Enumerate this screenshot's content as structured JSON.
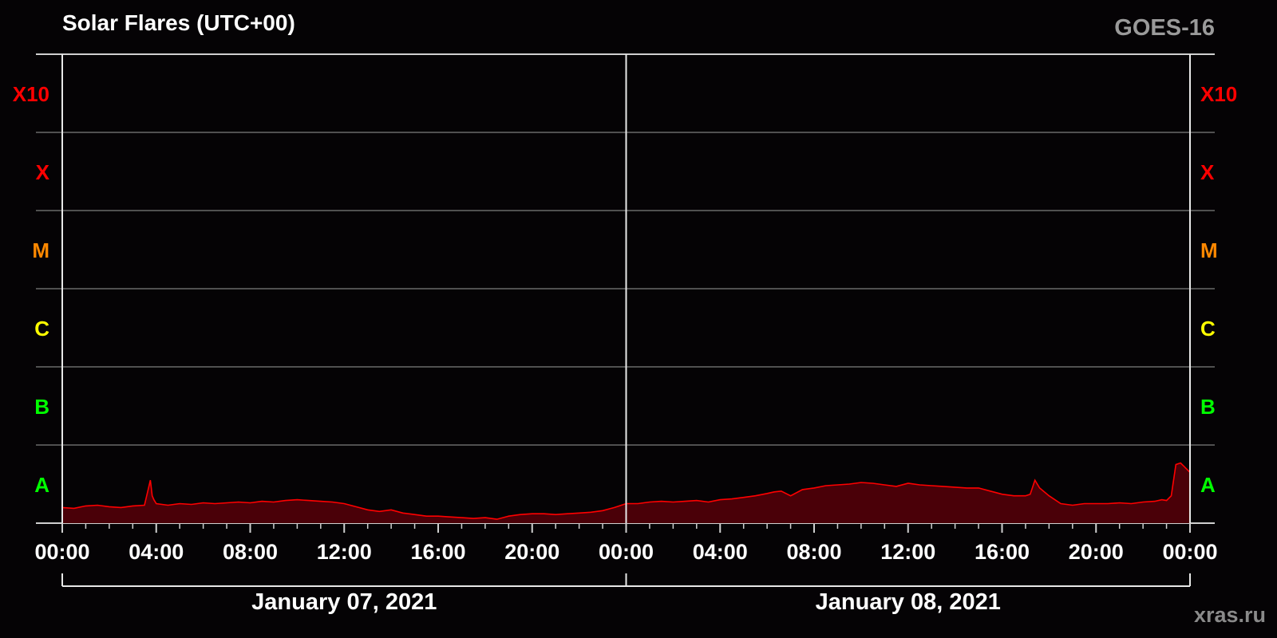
{
  "chart_data": {
    "type": "area",
    "title": "Solar Flares (UTC+00)",
    "satellite": "GOES-16",
    "credit": "xras.ru",
    "y_classes": [
      {
        "label": "A",
        "color": "#00ff00"
      },
      {
        "label": "B",
        "color": "#00ff00"
      },
      {
        "label": "C",
        "color": "#ffff00"
      },
      {
        "label": "M",
        "color": "#ff8800"
      },
      {
        "label": "X",
        "color": "#ff0000"
      },
      {
        "label": "X10",
        "color": "#ff0000"
      }
    ],
    "y_scale": "log10 X-ray flux class, band 0 = A (1e-8 W/m2) ... band 5 = X10",
    "ylim": [
      0,
      6
    ],
    "x_ticks": [
      "00:00",
      "04:00",
      "08:00",
      "12:00",
      "16:00",
      "20:00",
      "00:00",
      "04:00",
      "08:00",
      "12:00",
      "16:00",
      "20:00",
      "00:00"
    ],
    "xlim_hours": [
      0,
      48
    ],
    "dates": [
      {
        "label": "January 07, 2021",
        "start_hour": 0,
        "end_hour": 24
      },
      {
        "label": "January 08, 2021",
        "start_hour": 24,
        "end_hour": 48
      }
    ],
    "grid": true,
    "series": [
      {
        "color": "#ff0000",
        "fill": "#4a0008",
        "x_hours": [
          0,
          0.5,
          1,
          1.5,
          2,
          2.5,
          3,
          3.5,
          3.75,
          3.83,
          3.9,
          4,
          4.5,
          5,
          5.5,
          6,
          6.5,
          7,
          7.5,
          8,
          8.5,
          9,
          9.5,
          10,
          10.5,
          11,
          11.5,
          12,
          12.5,
          13,
          13.5,
          14,
          14.5,
          15,
          15.5,
          16,
          16.5,
          17,
          17.5,
          18,
          18.5,
          19,
          19.5,
          20,
          20.5,
          21,
          21.5,
          22,
          22.5,
          23,
          23.5,
          24,
          24.5,
          25,
          25.5,
          26,
          26.5,
          27,
          27.5,
          28,
          28.5,
          29,
          29.5,
          30,
          30.3,
          30.6,
          31,
          31.5,
          32,
          32.5,
          33,
          33.5,
          34,
          34.5,
          35,
          35.5,
          36,
          36.5,
          37,
          37.5,
          38,
          38.5,
          39,
          39.5,
          40,
          40.5,
          41,
          41.2,
          41.4,
          41.6,
          42,
          42.5,
          43,
          43.5,
          44,
          44.5,
          45,
          45.5,
          46,
          46.5,
          46.8,
          47,
          47.2,
          47.4,
          47.6,
          48
        ],
        "y_band": [
          0.15,
          0.14,
          0.17,
          0.18,
          0.16,
          0.15,
          0.17,
          0.18,
          0.5,
          0.3,
          0.25,
          0.2,
          0.18,
          0.2,
          0.19,
          0.21,
          0.2,
          0.21,
          0.22,
          0.21,
          0.23,
          0.22,
          0.24,
          0.25,
          0.24,
          0.23,
          0.22,
          0.2,
          0.16,
          0.12,
          0.1,
          0.12,
          0.08,
          0.06,
          0.04,
          0.04,
          0.03,
          0.02,
          0.01,
          0.02,
          0.0,
          0.04,
          0.06,
          0.07,
          0.07,
          0.06,
          0.07,
          0.08,
          0.09,
          0.11,
          0.15,
          0.2,
          0.2,
          0.22,
          0.23,
          0.22,
          0.23,
          0.24,
          0.22,
          0.25,
          0.26,
          0.28,
          0.3,
          0.33,
          0.35,
          0.36,
          0.3,
          0.38,
          0.4,
          0.43,
          0.44,
          0.45,
          0.47,
          0.46,
          0.44,
          0.42,
          0.46,
          0.44,
          0.43,
          0.42,
          0.41,
          0.4,
          0.4,
          0.36,
          0.32,
          0.3,
          0.3,
          0.32,
          0.5,
          0.4,
          0.3,
          0.2,
          0.18,
          0.2,
          0.2,
          0.2,
          0.21,
          0.2,
          0.22,
          0.23,
          0.25,
          0.24,
          0.3,
          0.7,
          0.72,
          0.6,
          0.5
        ]
      }
    ]
  }
}
